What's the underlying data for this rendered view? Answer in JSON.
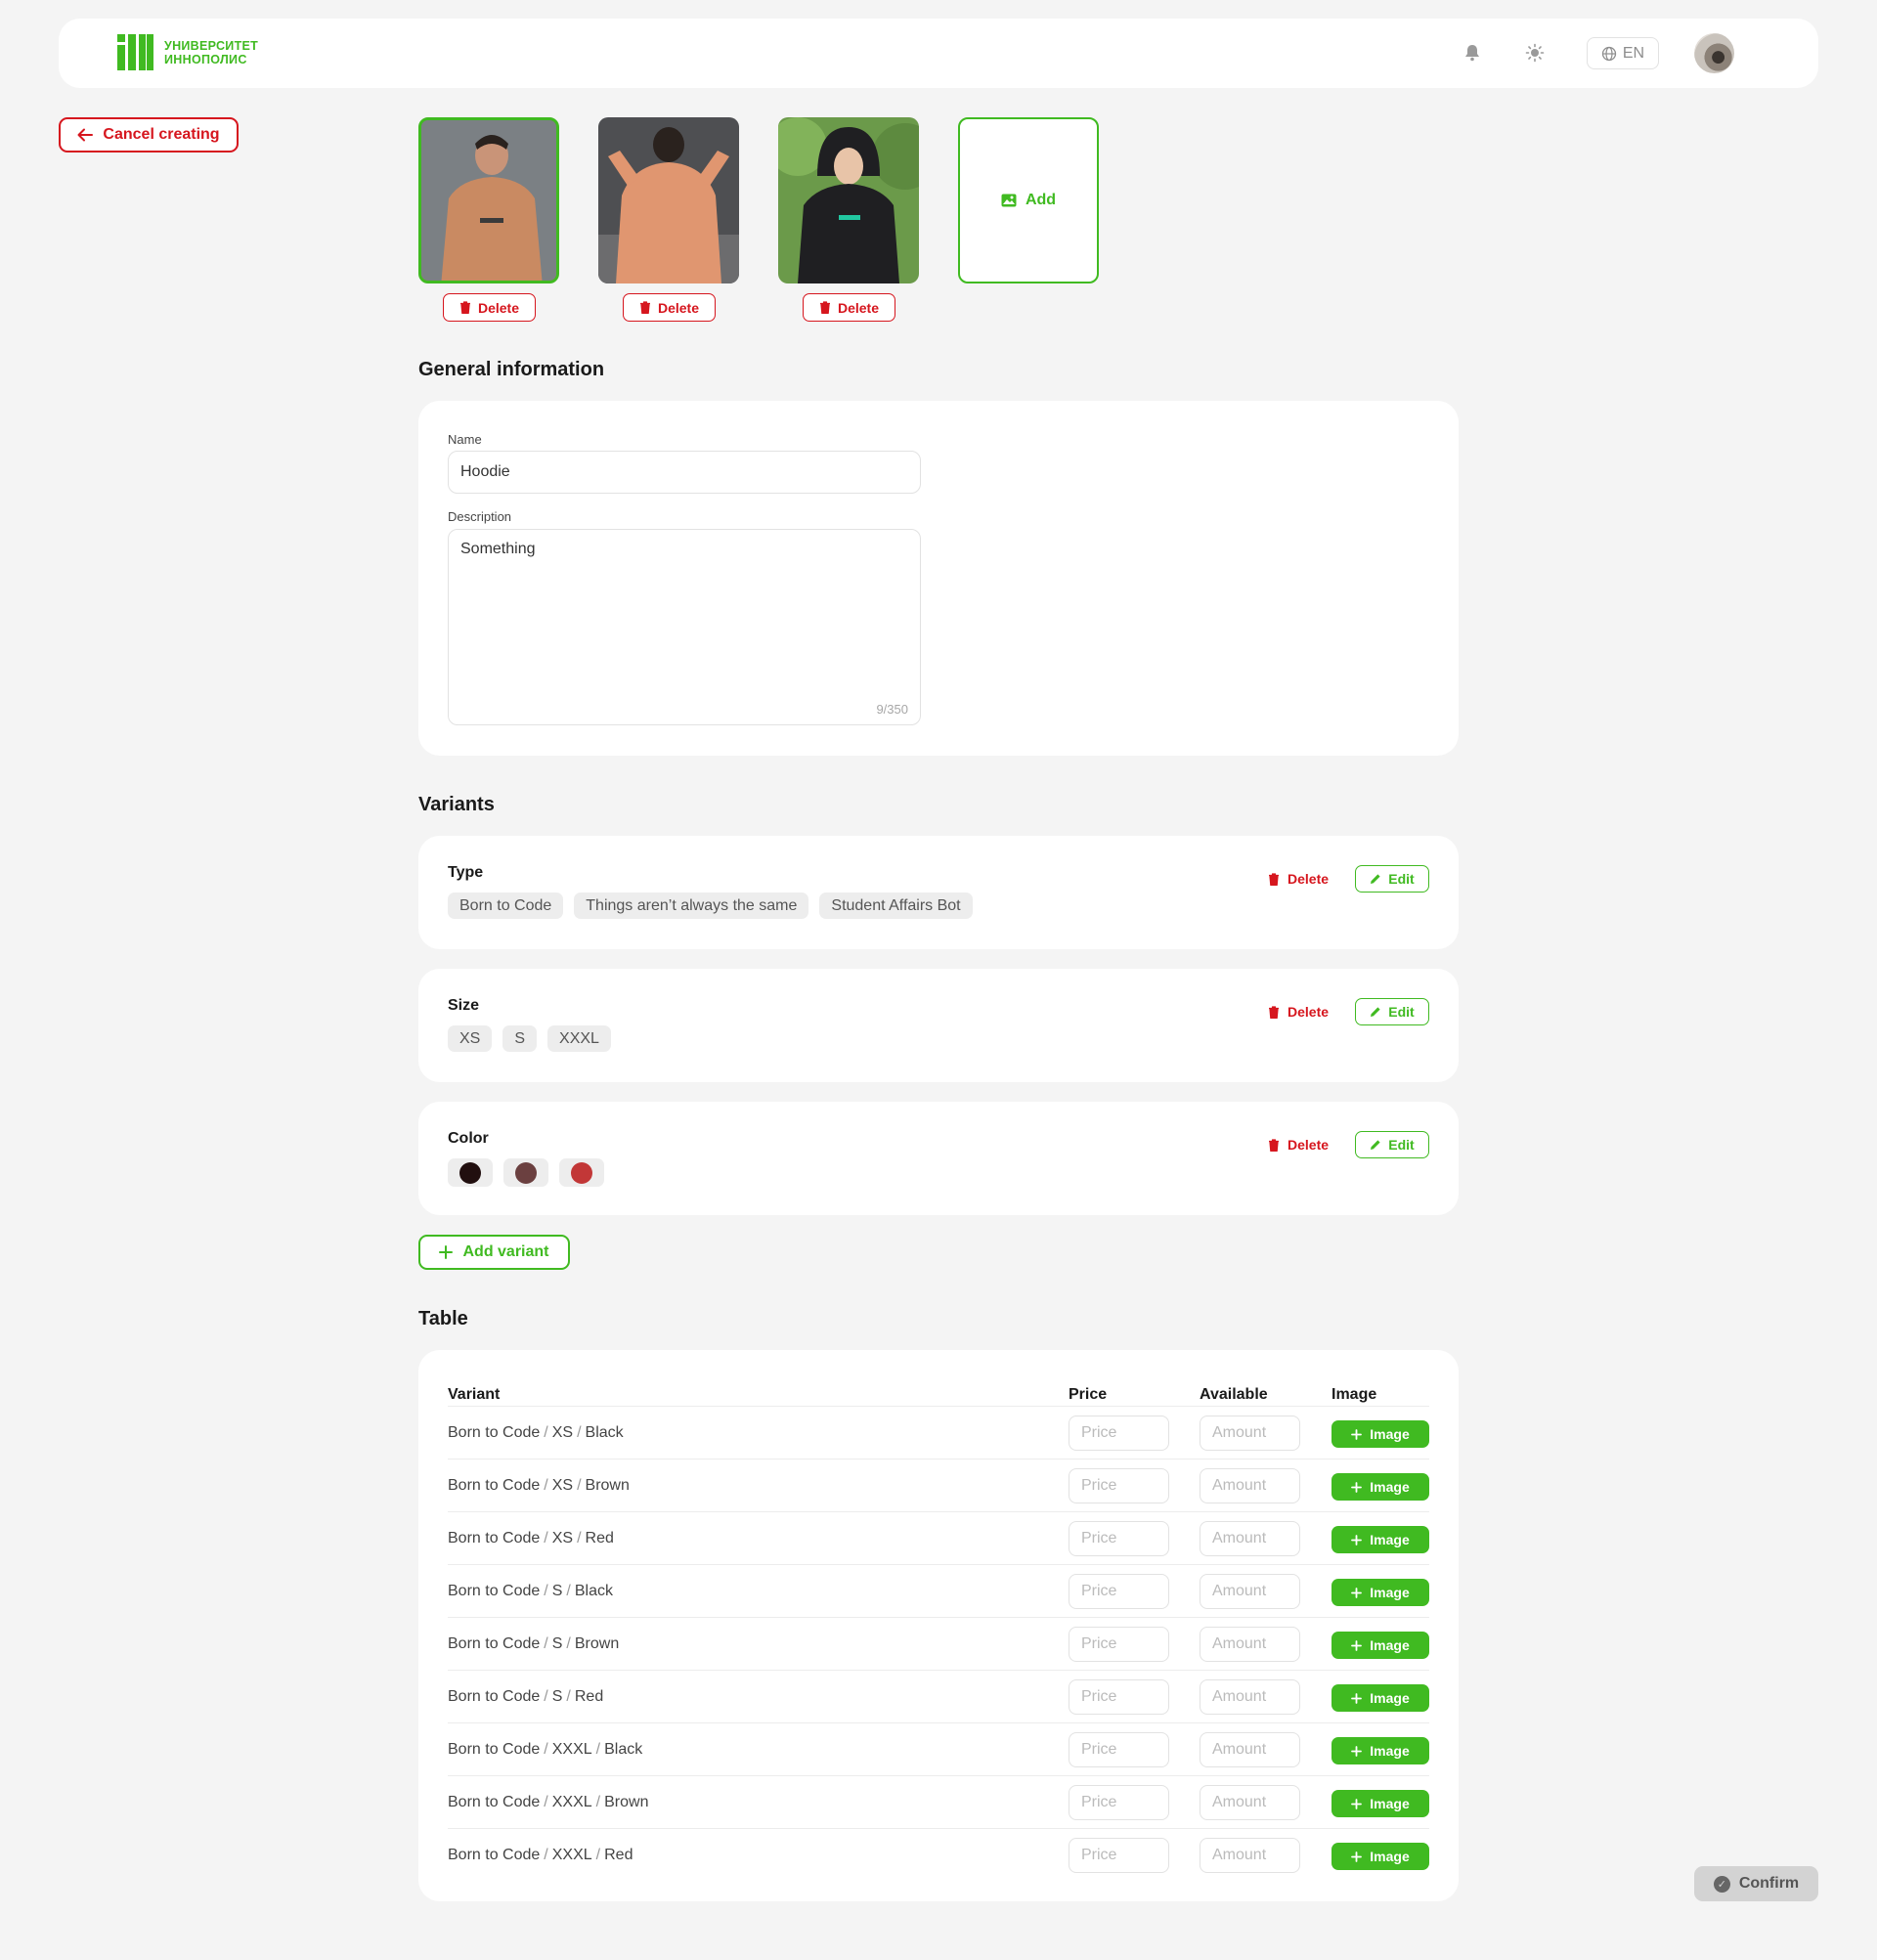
{
  "header": {
    "logo_line1": "УНИВЕРСИТЕТ",
    "logo_line2": "ИННОПОЛИС",
    "language": "EN",
    "icons": [
      "bell-icon",
      "sun-icon",
      "globe-icon"
    ]
  },
  "cancel_label": "Cancel creating",
  "images": {
    "delete_label": "Delete",
    "add_label": "Add",
    "items": [
      {
        "desc": "orange hoodie front",
        "selected": true
      },
      {
        "desc": "orange hoodie back",
        "selected": false
      },
      {
        "desc": "black hoodie",
        "selected": false
      }
    ]
  },
  "general": {
    "title": "General information",
    "name_label": "Name",
    "name_value": "Hoodie",
    "description_label": "Description",
    "description_value": "Something",
    "counter": "9/350"
  },
  "variants": {
    "title": "Variants",
    "delete_label": "Delete",
    "edit_label": "Edit",
    "add_label": "Add variant",
    "type": {
      "title": "Type",
      "options": [
        "Born to Code",
        "Things aren’t always the same",
        "Student Affairs Bot"
      ]
    },
    "size": {
      "title": "Size",
      "options": [
        "XS",
        "S",
        "XXXL"
      ]
    },
    "color": {
      "title": "Color",
      "options": [
        "#210f0f",
        "#6b4040",
        "#c23737"
      ]
    }
  },
  "table": {
    "title": "Table",
    "headers": {
      "variant": "Variant",
      "price": "Price",
      "available": "Available",
      "image": "Image"
    },
    "price_placeholder": "Price",
    "amount_placeholder": "Amount",
    "image_button": "Image",
    "rows": [
      [
        "Born to Code",
        "XS",
        "Black"
      ],
      [
        "Born to Code",
        "XS",
        "Brown"
      ],
      [
        "Born to Code",
        "XS",
        "Red"
      ],
      [
        "Born to Code",
        "S",
        "Black"
      ],
      [
        "Born to Code",
        "S",
        "Brown"
      ],
      [
        "Born to Code",
        "S",
        "Red"
      ],
      [
        "Born to Code",
        "XXXL",
        "Black"
      ],
      [
        "Born to Code",
        "XXXL",
        "Brown"
      ],
      [
        "Born to Code",
        "XXXL",
        "Red"
      ]
    ]
  },
  "confirm_label": "Confirm",
  "colors": {
    "accent": "#40ba21",
    "danger": "#d6161e",
    "background": "#f4f4f4"
  }
}
